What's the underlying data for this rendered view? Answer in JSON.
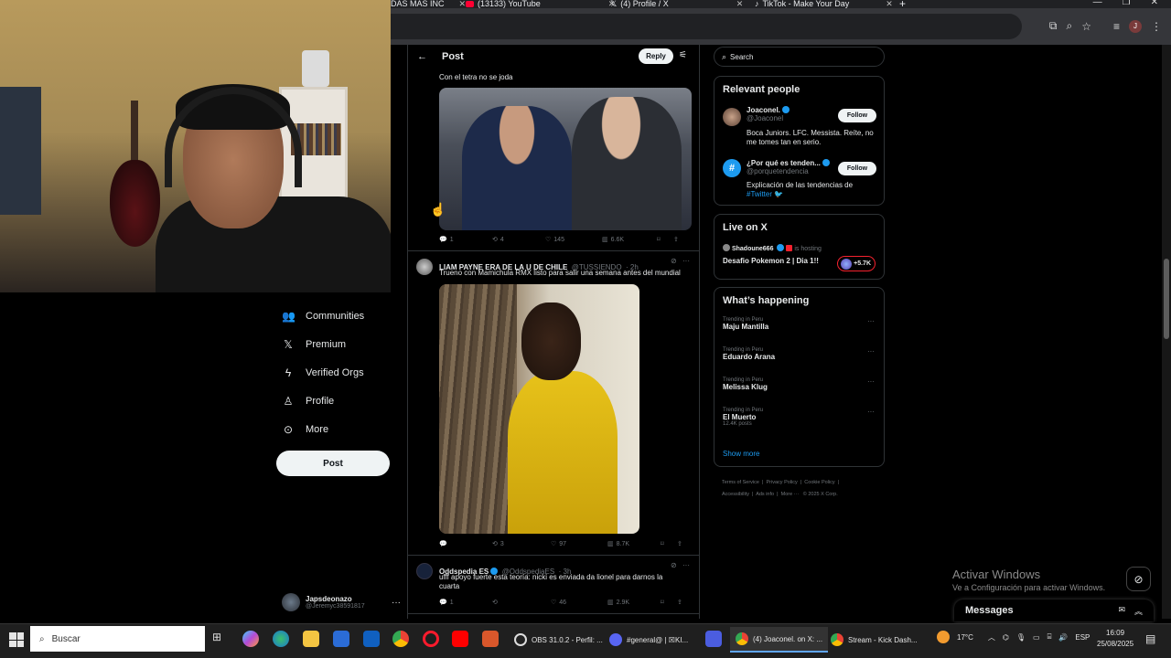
{
  "browser": {
    "tabs": [
      {
        "label": "DAS MAS INC"
      },
      {
        "label": "(13133) YouTube"
      },
      {
        "label": "(4) Profile / X"
      },
      {
        "label": "TikTok - Make Your Day"
      }
    ],
    "new_tab": "+",
    "profile_initial": "J"
  },
  "nav": {
    "items": [
      {
        "label": "Communities",
        "icon": "communities-icon"
      },
      {
        "label": "Premium",
        "icon": "x-logo-icon"
      },
      {
        "label": "Verified Orgs",
        "icon": "lightning-icon"
      },
      {
        "label": "Profile",
        "icon": "person-icon"
      },
      {
        "label": "More",
        "icon": "more-circle-icon"
      }
    ],
    "post_label": "Post",
    "account": {
      "name": "Japsdeonazo",
      "handle": "@Jeremyc38591817"
    }
  },
  "post_header": {
    "title": "Post",
    "reply_label": "Reply"
  },
  "tweets": [
    {
      "text": "Con el tetra no se joda",
      "actions": {
        "replies": "1",
        "reposts": "4",
        "likes": "145",
        "views": "6.6K"
      }
    },
    {
      "name": "LIAM PAYNE ERA DE LA U DE CHILE",
      "handle": "@TUSSIENDO",
      "time": "· 2h",
      "text": "Trueno con Mamichula RMX listo para salir una semana antes del mundial",
      "actions": {
        "replies": "",
        "reposts": "3",
        "likes": "97",
        "views": "8.7K"
      }
    },
    {
      "name": "Oddspedia ES",
      "handle": "@OddspediaES",
      "time": "· 3h",
      "text": "ufff apoyo fuerte esta teoría: nicki es enviada da lionel para darnos la cuarta",
      "actions": {
        "replies": "1",
        "reposts": "",
        "likes": "46",
        "views": "2.9K"
      }
    }
  ],
  "sidebar": {
    "search_placeholder": "Search",
    "relevant_title": "Relevant people",
    "people": [
      {
        "name": "Joaconel.",
        "handle": "@Joaconel",
        "bio": "Boca Juniors. LFC. Messista. Reíte, no me tomes tan en serio.",
        "follow": "Follow"
      },
      {
        "name": "¿Por qué es tenden...",
        "handle": "@porquetendencia",
        "bio": "Explicación de las tendencias de",
        "hashtag": "#Twitter",
        "follow": "Follow"
      }
    ],
    "live_title": "Live on X",
    "live": {
      "host": "Shadoune666",
      "hosting": "is hosting",
      "title": "Desafio Pokemon 2 | Dia 1!!",
      "count": "+5.7K"
    },
    "happening_title": "What’s happening",
    "trends": [
      {
        "context": "Trending in Peru",
        "name": "Maju Mantilla",
        "posts": ""
      },
      {
        "context": "Trending in Peru",
        "name": "Eduardo Arana",
        "posts": ""
      },
      {
        "context": "Trending in Peru",
        "name": "Melissa Klug",
        "posts": ""
      },
      {
        "context": "Trending in Peru",
        "name": "El Muerto",
        "posts": "12.4K posts"
      }
    ],
    "show_more": "Show more",
    "footer": [
      "Terms of Service",
      "Privacy Policy",
      "Cookie Policy",
      "Accessibility",
      "Ads info",
      "More ···",
      "© 2025 X Corp."
    ]
  },
  "windows": {
    "activate_title": "Activar Windows",
    "activate_sub": "Ve a Configuración para activar Windows.",
    "messages_label": "Messages"
  },
  "taskbar": {
    "search_placeholder": "Buscar",
    "apps": [
      {
        "label": "OBS 31.0.2 - Perfil: ..."
      },
      {
        "label": "#general@ | ☒KI..."
      },
      {
        "label": "(4) Joaconel. on X: ..."
      },
      {
        "label": "Stream - Kick Dash..."
      }
    ],
    "weather": "17°C",
    "lang": "ESP",
    "time": "16:09",
    "date": "25/08/2025"
  }
}
